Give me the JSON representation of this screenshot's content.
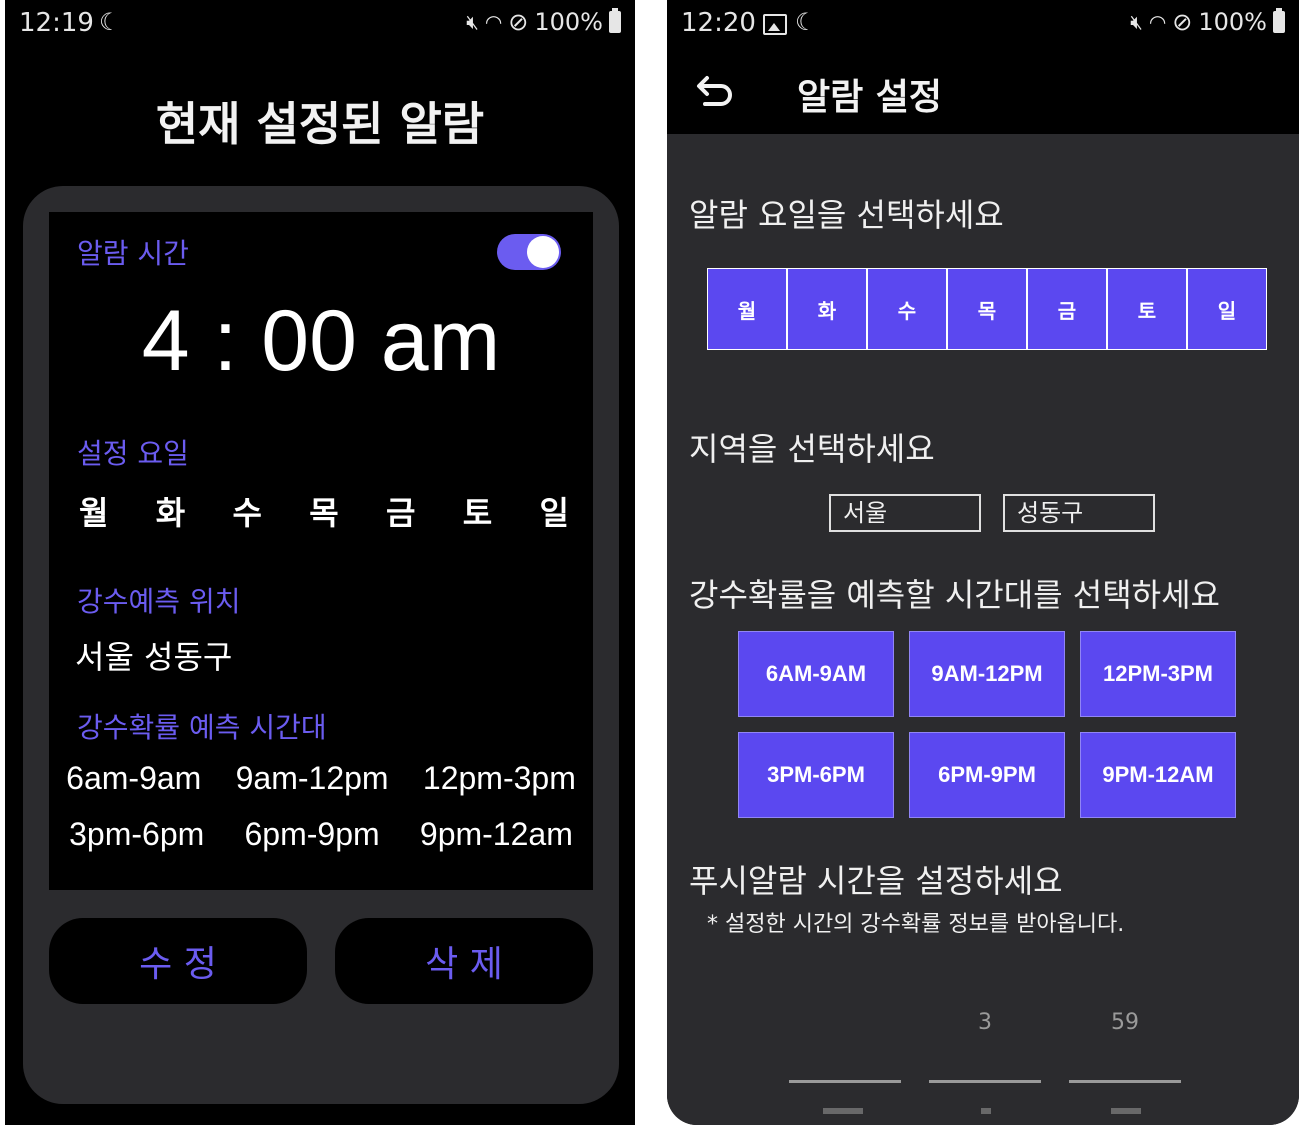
{
  "left": {
    "status": {
      "time": "12:19",
      "battery": "100%"
    },
    "title": "현재 설정된 알람",
    "alarm_label": "알람 시간",
    "alarm_time": "4 : 00 am",
    "alarm_enabled": true,
    "days_label": "설정 요일",
    "days": [
      "월",
      "화",
      "수",
      "목",
      "금",
      "토",
      "일"
    ],
    "location_label": "강수예측 위치",
    "location": "서울 성동구",
    "timeslot_label": "강수확률 예측 시간대",
    "timeslots_row1": [
      "6am-9am",
      "9am-12pm",
      "12pm-3pm"
    ],
    "timeslots_row2": [
      "3pm-6pm",
      "6pm-9pm",
      "9pm-12am"
    ],
    "edit_button": "수 정",
    "delete_button": "삭 제"
  },
  "right": {
    "status": {
      "time": "12:20",
      "battery": "100%"
    },
    "title": "알람 설정",
    "weekday_prompt": "알람 요일을 선택하세요",
    "weekdays": [
      "월",
      "화",
      "수",
      "목",
      "금",
      "토",
      "일"
    ],
    "region_prompt": "지역을 선택하세요",
    "region_city": "서울",
    "region_district": "성동구",
    "timeslot_prompt": "강수확률을 예측할 시간대를 선택하세요",
    "timeslots": [
      "6AM-9AM",
      "9AM-12PM",
      "12PM-3PM",
      "3PM-6PM",
      "6PM-9PM",
      "9PM-12AM"
    ],
    "push_prompt": "푸시알람 시간을 설정하세요",
    "push_note": "* 설정한 시간의 강수확률 정보를 받아옵니다.",
    "picker": {
      "hour": "3",
      "minute": "59"
    }
  },
  "colors": {
    "accent": "#6b5cf0",
    "button": "#5b48f0",
    "card": "#2b2b2e"
  }
}
